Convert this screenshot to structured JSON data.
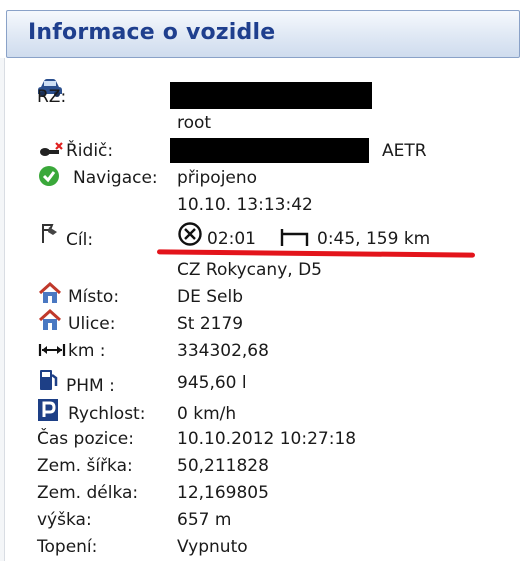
{
  "panel": {
    "title": "Informace o vozidle"
  },
  "icons": {
    "rz": "car-icon",
    "ridic": "driver-key-icon",
    "navigace": "check-circle-icon",
    "cil": "flags-icon",
    "misto": "house-icon",
    "ulice": "house-icon",
    "km": "distance-arrow-icon",
    "phm": "fuel-pump-icon",
    "rychlost": "parking-icon",
    "target": "crossed-circle-icon",
    "rest": "bed-icon"
  },
  "colors": {
    "title": "#1f3f8e",
    "underline": "#e3141b",
    "ok": "#3aa83a"
  },
  "rows": {
    "rz": {
      "label": "RZ:",
      "value": "root"
    },
    "ridic": {
      "label": "Řidič:",
      "suffix": "AETR"
    },
    "navigace": {
      "label": "Navigace:",
      "value": "připojeno",
      "value2": "10.10. 13:13:42"
    },
    "cil": {
      "label": "Cíl:",
      "time": "02:01",
      "rest": "0:45, 159 km",
      "dest": "CZ Rokycany, D5"
    },
    "misto": {
      "label": "Místo:",
      "value": "DE Selb"
    },
    "ulice": {
      "label": "Ulice:",
      "value": "St 2179"
    },
    "km": {
      "label": "km :",
      "value": "334302,68"
    },
    "phm": {
      "label": "PHM :",
      "value": "945,60 l"
    },
    "rychlost": {
      "label": "Rychlost:",
      "value": "0 km/h"
    },
    "cas": {
      "label": "Čas pozice:",
      "value": "10.10.2012 10:27:18"
    },
    "sirka": {
      "label": "Zem. šířka:",
      "value": "50,211828"
    },
    "delka": {
      "label": "Zem. délka:",
      "value": "12,169805"
    },
    "vyska": {
      "label": "výška:",
      "value": "657 m"
    },
    "topeni": {
      "label": "Topení:",
      "value": "Vypnuto"
    }
  }
}
